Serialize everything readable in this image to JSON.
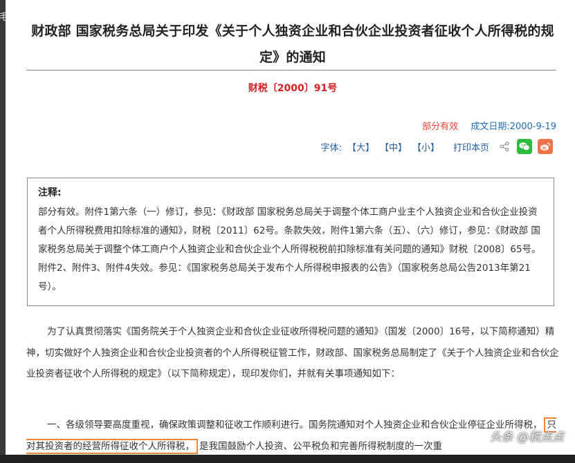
{
  "edge": {
    "left_char": "毛"
  },
  "doc": {
    "title": "财政部 国家税务总局关于印发《关于个人独资企业和合伙企业投资者征收个人所得税的规定》的通知",
    "doc_number": "财税〔2000〕91号",
    "status": "部分有效",
    "date_label": "成文日期:",
    "date": "2000-9-19"
  },
  "toolbar": {
    "font_label": "字体:",
    "font_large": "【大】",
    "font_medium": "【中】",
    "font_small": "【小】",
    "print_label": "打印本页",
    "icons": [
      "share-icon",
      "wechat-icon",
      "weibo-icon"
    ]
  },
  "note": {
    "title": "注释:",
    "body": "部分有效。附件1第六条（一）修订，参见：《财政部 国家税务总局关于调整个体工商户业主个人独资企业和合伙企业投资者个人所得税费用扣除标准的通知》，财税〔2011〕62号。条款失效，附件1第六条（五）、（六）修订，参见：《财政部 国家税务总局关于调整个体工商户个人独资企业和合伙企业个人所得税税前扣除标准有关问题的通知》财税〔2008〕65号。附件2、附件3、附件4失效。参见：《国家税务总局关于发布个人所得税申报表的公告》（国家税务总局公告2013年第21号）。"
  },
  "body": {
    "p1": "为了认真贯彻落实《国务院关于个人独资企业和合伙企业征收所得税问题的通知》（国发〔2000〕16号，以下简称通知）精神，切实做好个人独资企业和合伙企业投资者的个人所得税征管工作，财政部、国家税务总局制定了《关于个人独资企业和合伙企业投资者征收个人所得税的规定》（以下简称规定），现印发你们，并就有关事项通知如下：",
    "p2_a": "一、各级领导要高度重视，确保政策调整和征收工作顺利进行。国务院通知对个人独资企业和合伙企业停征企业所得税，",
    "p2_highlight": "只对其投资者的经营所得征收个人所得税，",
    "p2_b": "是我国鼓励个人投资、公平税负和完善所得税制度的一次重"
  },
  "watermark": "头条 @税点点",
  "colors": {
    "accent_red": "#d52121",
    "link_blue": "#1f5fa8",
    "highlight": "#f0843a",
    "wechat": "#2dbb3d",
    "weibo": "#f0734a"
  }
}
